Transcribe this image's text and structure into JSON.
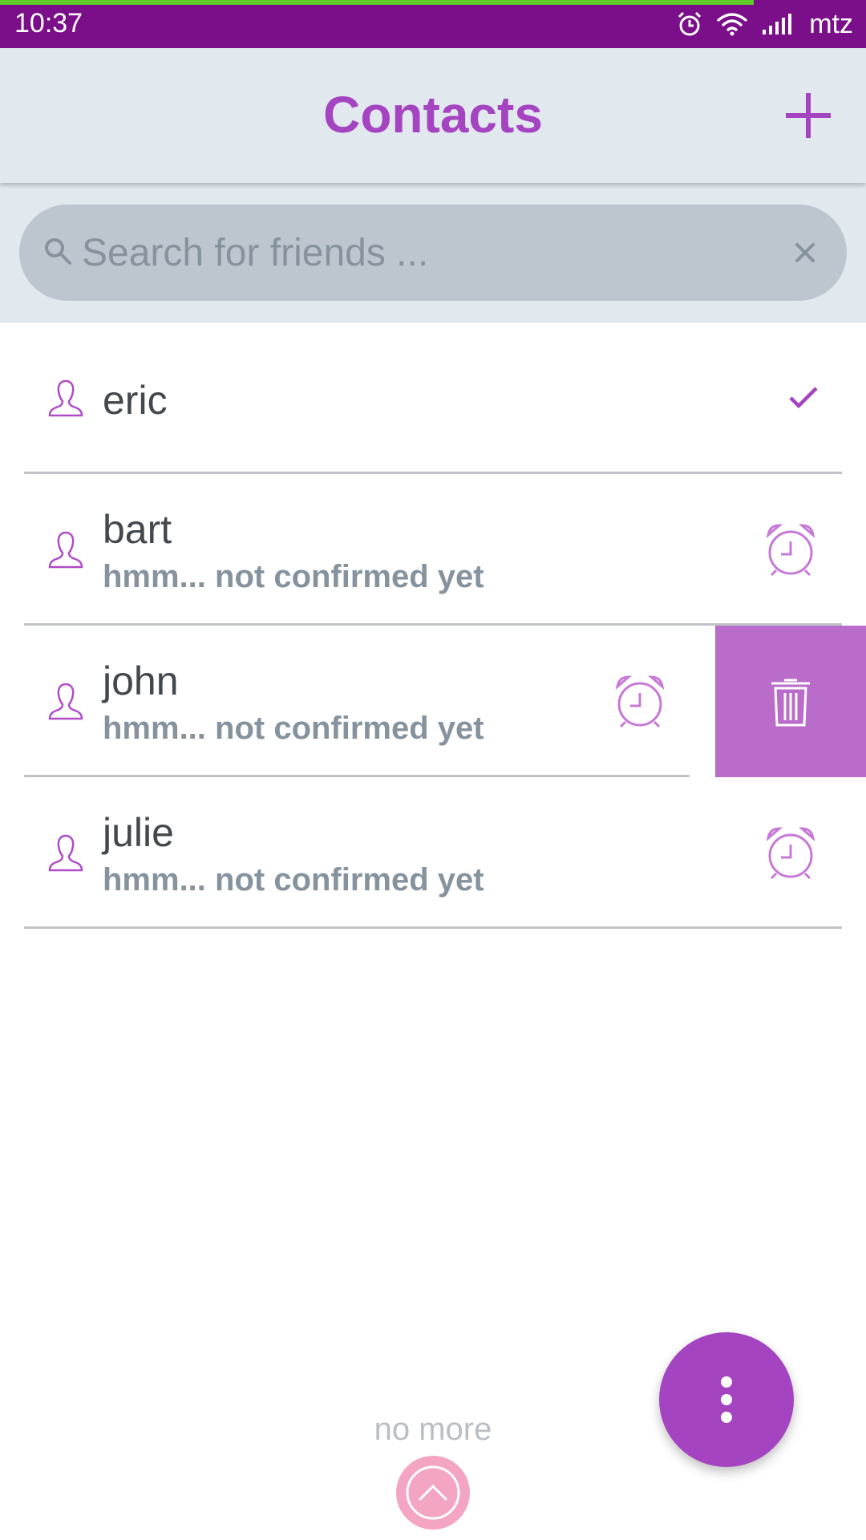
{
  "status_bar": {
    "time": "10:37",
    "carrier": "mtz",
    "icons": [
      "alarm-icon",
      "wifi-icon",
      "signal-icon"
    ],
    "background": "#7b0f8a",
    "progress_color": "#5ecf2a"
  },
  "header": {
    "title": "Contacts",
    "add_icon": "plus-icon",
    "accent": "#a544c0"
  },
  "search": {
    "placeholder": "Search for friends ...",
    "value": "",
    "icons": [
      "search-icon",
      "close-icon"
    ]
  },
  "contacts": [
    {
      "name": "eric",
      "subtitle": "",
      "status_icon": "check-icon"
    },
    {
      "name": "bart",
      "subtitle": "hmm... not confirmed yet",
      "status_icon": "alarm-clock-icon"
    },
    {
      "name": "john",
      "subtitle": "hmm... not confirmed yet",
      "status_icon": "alarm-clock-icon",
      "swipe_action": "trash-icon"
    },
    {
      "name": "julie",
      "subtitle": "hmm... not confirmed yet",
      "status_icon": "alarm-clock-icon"
    }
  ],
  "footer": {
    "no_more_text": "no more",
    "scroll_top_icon": "chevron-up-icon",
    "fab_icon": "more-vertical-icon"
  },
  "colors": {
    "header_bg": "#e1e8ee",
    "search_bg": "#bdc6cf",
    "delete_bg": "#b96cc9",
    "scroll_top_bg": "#f3a5c3"
  }
}
